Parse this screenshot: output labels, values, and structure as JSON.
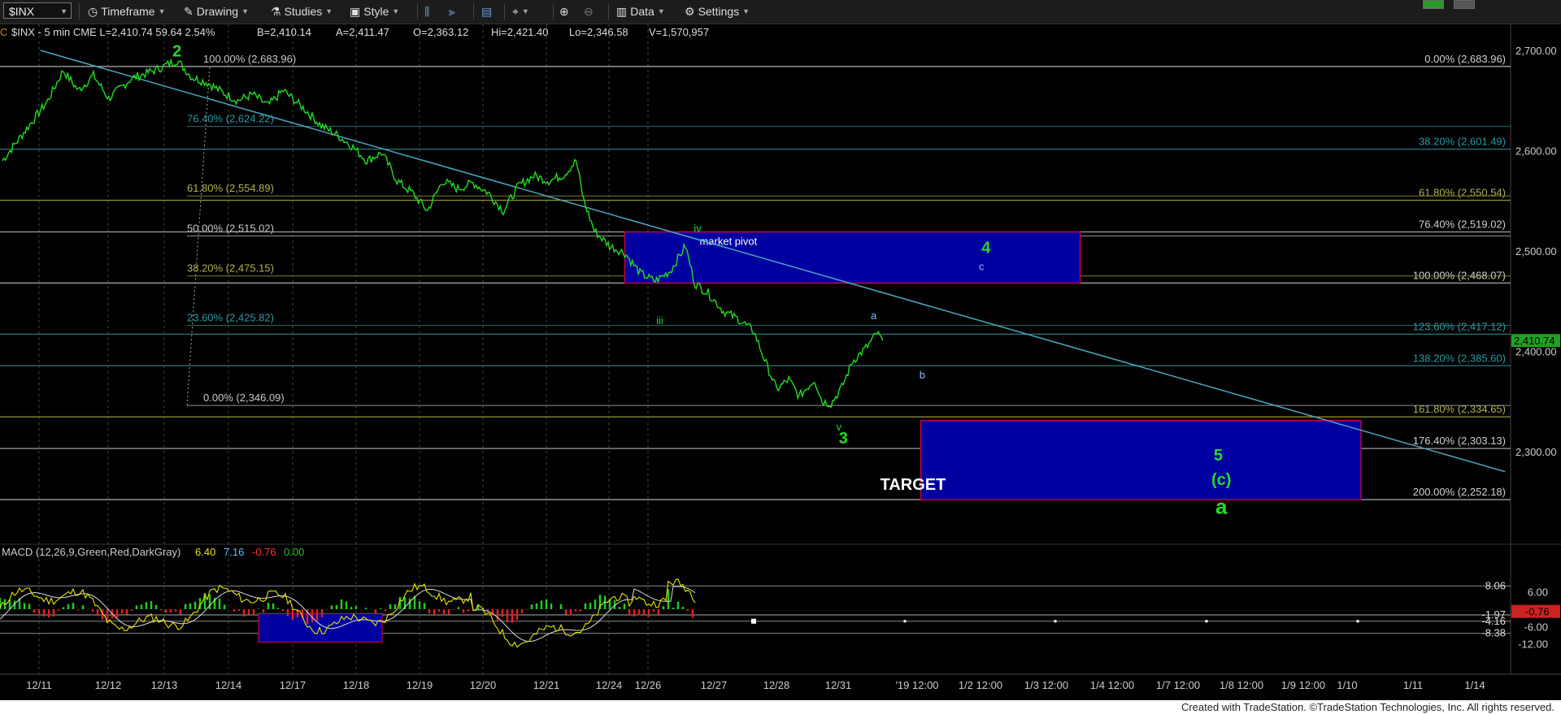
{
  "toolbar": {
    "symbol": "$INX",
    "items": [
      {
        "label": "Timeframe",
        "icon": "clock-icon"
      },
      {
        "label": "Drawing",
        "icon": "pencil-icon"
      },
      {
        "label": "Studies",
        "icon": "flask-icon"
      },
      {
        "label": "Style",
        "icon": "style-icon"
      },
      {
        "label": "Data",
        "icon": "bar-chart-icon"
      },
      {
        "label": "Settings",
        "icon": "gear-icon"
      }
    ]
  },
  "header": {
    "symbol_line": "$INX - 5 min  CME  L=2,410.74  59.64  2.54%",
    "symbol": "$INX - 5 min",
    "exchange": "CME",
    "last": "L=2,410.74",
    "change": "59.64",
    "change_pct": "2.54%",
    "bid": "B=2,410.14",
    "ask": "A=2,411.47",
    "open": "O=2,363.12",
    "high": "Hi=2,421.40",
    "low": "Lo=2,346.58",
    "volume": "V=1,570,957"
  },
  "chart_data": {
    "type": "line",
    "price_axis": {
      "ticks": [
        "2,700.00",
        "2,600.00",
        "2,500.00",
        "2,400.00",
        "2,300.00"
      ],
      "range": [
        2225,
        2710
      ]
    },
    "last_price_label": "2,410.74",
    "x_ticks": [
      "12/11",
      "12/12",
      "12/13",
      "12/14",
      "12/17",
      "12/18",
      "12/19",
      "12/20",
      "12/21",
      "12/24",
      "12/26",
      "12/27",
      "12/28",
      "12/31",
      "'19 12:00",
      "1/2 12:00",
      "1/3 12:00",
      "1/4 12:00",
      "1/7 12:00",
      "1/8 12:00",
      "1/9 12:00",
      "1/10",
      "1/11",
      "1/14"
    ],
    "price_path": [
      [
        0,
        2590
      ],
      [
        1.5,
        2620
      ],
      [
        3,
        2650
      ],
      [
        4,
        2680
      ],
      [
        5,
        2660
      ],
      [
        6,
        2675
      ],
      [
        7,
        2652
      ],
      [
        8.5,
        2672
      ],
      [
        10,
        2680
      ],
      [
        11.5,
        2690
      ],
      [
        12.5,
        2673
      ],
      [
        13.5,
        2668
      ],
      [
        14.5,
        2658
      ],
      [
        15.5,
        2650
      ],
      [
        16.5,
        2656
      ],
      [
        17.5,
        2645
      ],
      [
        18.5,
        2660
      ],
      [
        20,
        2640
      ],
      [
        21,
        2625
      ],
      [
        22,
        2616
      ],
      [
        23,
        2605
      ],
      [
        24,
        2590
      ],
      [
        25,
        2598
      ],
      [
        26,
        2570
      ],
      [
        27,
        2558
      ],
      [
        28,
        2540
      ],
      [
        29,
        2570
      ],
      [
        30,
        2562
      ],
      [
        31,
        2568
      ],
      [
        32,
        2558
      ],
      [
        33,
        2540
      ],
      [
        34,
        2565
      ],
      [
        35,
        2575
      ],
      [
        36,
        2570
      ],
      [
        37,
        2576
      ],
      [
        37.8,
        2590
      ],
      [
        38.3,
        2550
      ],
      [
        39,
        2520
      ],
      [
        40,
        2505
      ],
      [
        41,
        2498
      ],
      [
        42,
        2478
      ],
      [
        43,
        2470
      ],
      [
        44,
        2480
      ],
      [
        45,
        2505
      ],
      [
        45.6,
        2468
      ],
      [
        46.5,
        2458
      ],
      [
        47.5,
        2440
      ],
      [
        48.5,
        2432
      ],
      [
        49.5,
        2420
      ],
      [
        50.3,
        2388
      ],
      [
        51,
        2362
      ],
      [
        51.8,
        2372
      ],
      [
        52.5,
        2355
      ],
      [
        53.5,
        2372
      ],
      [
        54,
        2350
      ],
      [
        54.6,
        2348
      ],
      [
        55.3,
        2364
      ],
      [
        56,
        2390
      ],
      [
        57,
        2405
      ],
      [
        57.6,
        2418
      ],
      [
        58,
        2410.74
      ]
    ],
    "fib_retracements_left": [
      {
        "label": "100.00% (2,683.96)",
        "price": 2683.96
      },
      {
        "label": "76.40% (2,624.22)",
        "price": 2624.22
      },
      {
        "label": "61.80% (2,554.89)",
        "price": 2554.89
      },
      {
        "label": "50.00% (2,515.02)",
        "price": 2515.02
      },
      {
        "label": "38.20% (2,475.15)",
        "price": 2475.15
      },
      {
        "label": "23.60% (2,425.82)",
        "price": 2425.82
      },
      {
        "label": "0.00% (2,346.09)",
        "price": 2346.09
      }
    ],
    "fib_extensions_right": [
      {
        "label": "0.00% (2,683.96)",
        "price": 2683.96
      },
      {
        "label": "38.20% (2,601.49)",
        "price": 2601.49
      },
      {
        "label": "61.80% (2,550.54)",
        "price": 2550.54
      },
      {
        "label": "76.40% (2,519.02)",
        "price": 2519.02
      },
      {
        "label": "100.00% (2,468.07)",
        "price": 2468.07
      },
      {
        "label": "123.60% (2,417.12)",
        "price": 2417.12
      },
      {
        "label": "138.20% (2,385.60)",
        "price": 2385.6
      },
      {
        "label": "161.80% (2,334.65)",
        "price": 2334.65
      },
      {
        "label": "176.40% (2,303.13)",
        "price": 2303.13
      },
      {
        "label": "200.00% (2,252.18)",
        "price": 2252.18
      }
    ],
    "trendline": {
      "from": [
        2.5,
        2700
      ],
      "to": [
        99,
        2280
      ]
    },
    "pivot_box": {
      "label": "market pivot",
      "x": [
        41,
        71
      ],
      "price": [
        2468,
        2519
      ]
    },
    "target_box": {
      "label": "TARGET",
      "x": [
        60.5,
        89.5
      ],
      "price": [
        2252,
        2331
      ]
    },
    "wave_labels": [
      {
        "text": "2",
        "x": 11.5,
        "price": 2694,
        "color": "green",
        "size": "big"
      },
      {
        "text": "iv",
        "x": 45.8,
        "price": 2519,
        "color": "green",
        "size": "small"
      },
      {
        "text": "4",
        "x": 64.8,
        "price": 2498,
        "color": "green",
        "size": "big"
      },
      {
        "text": "c",
        "x": 64.5,
        "price": 2481,
        "color": "blue",
        "size": "small"
      },
      {
        "text": "iii",
        "x": 43.3,
        "price": 2427,
        "color": "green",
        "size": "small"
      },
      {
        "text": "a",
        "x": 57.4,
        "price": 2432,
        "color": "blue",
        "size": "small"
      },
      {
        "text": "b",
        "x": 60.6,
        "price": 2373,
        "color": "blue",
        "size": "small"
      },
      {
        "text": "v",
        "x": 55.1,
        "price": 2321,
        "color": "green",
        "size": "small"
      },
      {
        "text": "3",
        "x": 55.4,
        "price": 2308,
        "color": "green",
        "size": "big"
      },
      {
        "text": "5",
        "x": 80.1,
        "price": 2291,
        "color": "green",
        "size": "big"
      },
      {
        "text": "(c)",
        "x": 80.3,
        "price": 2267,
        "color": "green",
        "size": "big"
      },
      {
        "text": "a",
        "x": 80.3,
        "price": 2238,
        "color": "green",
        "size": "huge"
      }
    ]
  },
  "macd": {
    "title": "MACD (12,26,9,Green,Red,DarkGray)",
    "values": [
      "6.40",
      "7.16",
      "-0.76",
      "0.00"
    ],
    "value_colors": [
      "#e6e600",
      "#55c8ff",
      "#ff3333",
      "#22c022"
    ],
    "axis_ticks": [
      "6.00",
      "-6.00",
      "-12.00"
    ],
    "right_labels": [
      "8.06",
      "-1.97",
      "-4.16",
      "-8.38"
    ],
    "current_label": "-0.76"
  },
  "footer": "Created with TradeStation. ©TradeStation Technologies, Inc. All rights reserved.",
  "colors": {
    "price": "#22dd22",
    "fib": "#a0a0a0",
    "teal": "#2a7a80",
    "olive": "#8a8a3a",
    "trend": "#4aa8c0",
    "box": "#0000a0",
    "box_border": "#c00040"
  }
}
